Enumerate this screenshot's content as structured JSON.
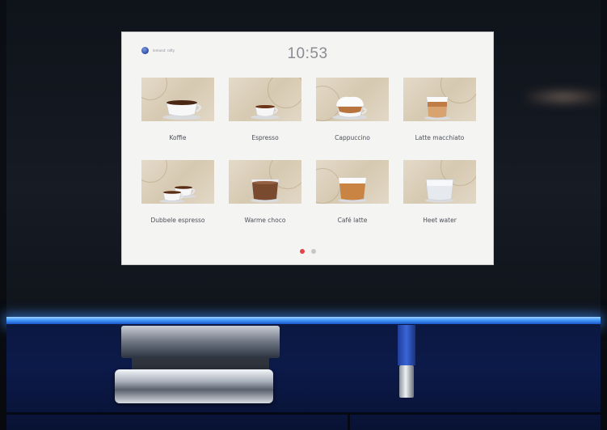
{
  "status_bar": {
    "logo_icon": "brand-globe-icon",
    "user_label": "Iemand: rafty",
    "time": "10:53"
  },
  "drinks": [
    {
      "label": "Koffie",
      "icon": "coffee-cup-icon"
    },
    {
      "label": "Espresso",
      "icon": "espresso-cup-icon"
    },
    {
      "label": "Cappuccino",
      "icon": "cappuccino-cup-icon"
    },
    {
      "label": "Latte macchiato",
      "icon": "latte-macchiato-glass-icon"
    },
    {
      "label": "Dubbele espresso",
      "icon": "double-espresso-cups-icon"
    },
    {
      "label": "Warme choco",
      "icon": "hot-chocolate-glass-icon"
    },
    {
      "label": "Café latte",
      "icon": "cafe-latte-glass-icon"
    },
    {
      "label": "Heet water",
      "icon": "hot-water-glass-icon"
    }
  ],
  "pagination": {
    "current": 1,
    "total": 2,
    "active_color": "#e0454a",
    "inactive_color": "#c7c7c7"
  },
  "colors": {
    "screen_bg": "#f4f4f3",
    "led_strip": "#4aa0ff",
    "tile_bg": "#ddd1bd"
  }
}
